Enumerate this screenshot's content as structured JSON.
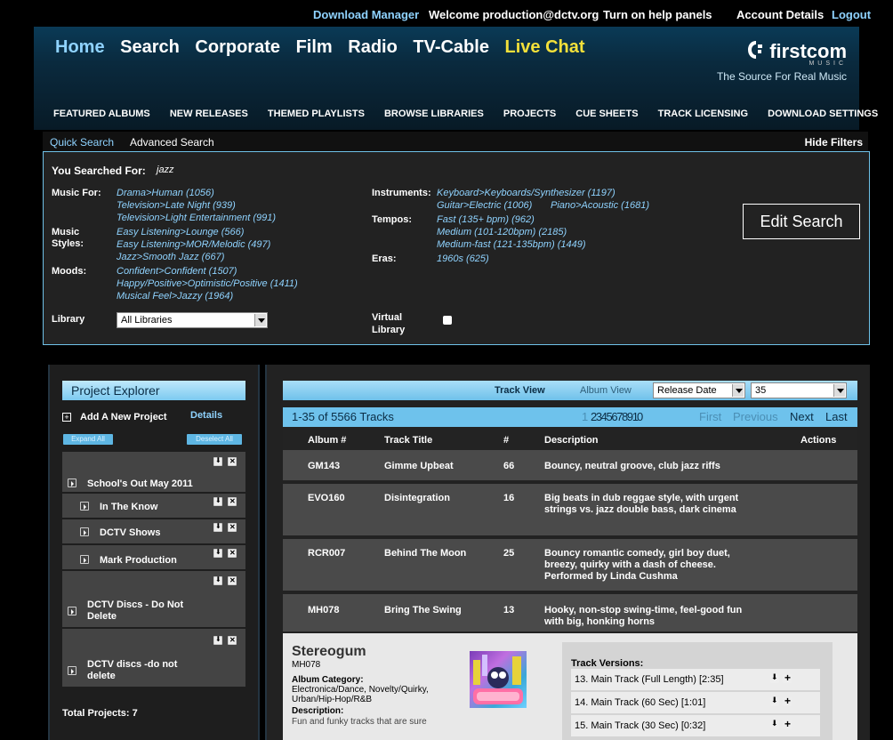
{
  "topbar": {
    "download_manager": "Download Manager",
    "welcome": "Welcome production@dctv.org",
    "help": "Turn on help panels",
    "account": "Account Details",
    "logout": "Logout"
  },
  "header": {
    "nav": [
      "Home",
      "Search",
      "Corporate",
      "Film",
      "Radio",
      "TV-Cable",
      "Live Chat"
    ],
    "logo_brand": "firstcom",
    "logo_sub": "MUSIC",
    "tagline": "The Source For Real Music",
    "subnav": [
      "FEATURED ALBUMS",
      "NEW RELEASES",
      "THEMED PLAYLISTS",
      "BROWSE LIBRARIES",
      "PROJECTS",
      "CUE SHEETS",
      "TRACK LICENSING",
      "DOWNLOAD SETTINGS"
    ]
  },
  "search_tabs": {
    "quick": "Quick Search",
    "advanced": "Advanced Search",
    "hide_filters": "Hide Filters"
  },
  "filters": {
    "searched_label": "You Searched For:",
    "searched_value": "jazz",
    "music_for_label": "Music For:",
    "music_for": [
      "Drama>Human (1056)",
      "Television>Late Night (939)",
      "Television>Light Entertainment (991)"
    ],
    "styles_label_1": "Music",
    "styles_label_2": "Styles:",
    "styles": [
      "Easy Listening>Lounge (566)",
      "Easy Listening>MOR/Melodic (497)",
      "Jazz>Smooth Jazz (667)"
    ],
    "moods_label": "Moods:",
    "moods": [
      "Confident>Confident (1507)",
      "Happy/Positive>Optimistic/Positive (1411)",
      "Musical Feel>Jazzy (1964)"
    ],
    "library_label": "Library",
    "library_value": "All Libraries",
    "instruments_label": "Instruments:",
    "instruments": [
      "Keyboard>Keyboards/Synthesizer (1197)",
      "Guitar>Electric (1006)",
      "Piano>Acoustic (1681)"
    ],
    "tempos_label": "Tempos:",
    "tempos": [
      "Fast (135+ bpm) (962)",
      "Medium (101-120bpm) (2185)",
      "Medium-fast (121-135bpm) (1449)"
    ],
    "eras_label": "Eras:",
    "eras": [
      "1960s (625)"
    ],
    "virtual_label_1": "Virtual",
    "virtual_label_2": "Library",
    "edit_search": "Edit Search"
  },
  "project_explorer": {
    "title": "Project Explorer",
    "add_new": "Add A New Project",
    "details": "Details",
    "expand_all": "Expand All",
    "deselect_all": "Deselect All",
    "projects": [
      "School's Out May 2011",
      "In The Know",
      "DCTV Shows",
      "Mark Production",
      "DCTV Discs - Do Not Delete",
      "DCTV discs -do not delete"
    ],
    "total": "Total Projects: 7"
  },
  "tracks": {
    "track_view": "Track View",
    "album_view": "Album View",
    "sort_value": "Release Date",
    "per_page_value": "35",
    "count": "1-35 of 5566 Tracks",
    "page_current": "1",
    "pages": "2 3 4 5 6 7 8 9 10",
    "first": "First",
    "previous": "Previous",
    "next": "Next",
    "last": "Last",
    "columns": [
      "Album #",
      "Track Title",
      "#",
      "Description",
      "Actions"
    ],
    "rows": [
      {
        "album": "GM143",
        "title": "Gimme Upbeat",
        "num": "66",
        "desc": "Bouncy, neutral groove, club jazz riffs"
      },
      {
        "album": "EVO160",
        "title": "Disintegration",
        "num": "16",
        "desc": "Big beats in dub reggae style, with urgent strings vs. jazz double bass, dark cinema"
      },
      {
        "album": "RCR007",
        "title": "Behind The Moon",
        "num": "25",
        "desc": "Bouncy romantic comedy, girl boy duet, breezy, quirky with a dash of cheese. Performed by Linda Cushma"
      },
      {
        "album": "MH078",
        "title": "Bring The Swing",
        "num": "13",
        "desc": "Hooky, non-stop swing-time, feel-good fun with big, honking horns"
      }
    ]
  },
  "album_detail": {
    "name": "Stereogum",
    "code": "MH078",
    "category_label": "Album Category:",
    "category": "Electronica/Dance, Novelty/Quirky, Urban/Hip-Hop/R&B",
    "description_label": "Description:",
    "description": "Fun and funky tracks that are sure",
    "versions_label": "Track Versions:",
    "versions": [
      "13. Main Track (Full Length) [2:35]",
      "14. Main Track (60 Sec) [1:01]",
      "15. Main Track (30 Sec) [0:32]"
    ]
  }
}
